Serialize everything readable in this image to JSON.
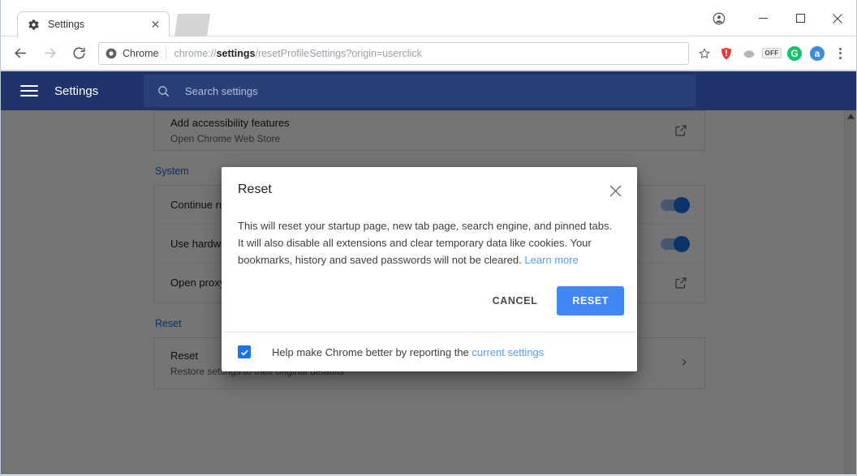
{
  "window": {
    "controls": {
      "avatar": "profile-avatar",
      "minimize": "—",
      "maximize": "□",
      "close": "✕"
    }
  },
  "tabs": [
    {
      "title": "Settings",
      "icon": "gear-icon",
      "close": "✕"
    }
  ],
  "newtab_label": "",
  "toolbar": {
    "back": "←",
    "forward": "→",
    "reload": "⟳",
    "chrome_badge": "Chrome",
    "url_prefix": "chrome://",
    "url_bold": "settings",
    "url_suffix": "/resetProfileSettings?origin=userclick",
    "url_full": "chrome://settings/resetProfileSettings?origin=userclick",
    "star": "☆",
    "extensions": [
      {
        "name": "shield-extension-icon",
        "label": "",
        "color": "#e53935"
      },
      {
        "name": "gray-globe-extension-icon",
        "label": "",
        "color": "#b0b0b0"
      },
      {
        "name": "off-badge-extension-icon",
        "label": "OFF",
        "color": "#4a4a4a"
      },
      {
        "name": "grammarly-extension-icon",
        "label": "G",
        "color": "#15c26b"
      },
      {
        "name": "amazon-assistant-extension-icon",
        "label": "a",
        "color": "#3c8ddc"
      }
    ],
    "menu": "⋮"
  },
  "settings_header": {
    "menu_icon": "hamburger-icon",
    "title": "Settings",
    "search_icon": "search-icon",
    "search_placeholder": "Search settings",
    "search_value": ""
  },
  "settings_page": {
    "accessibility_rows": [
      {
        "title": "Add accessibility features",
        "sub": "Open Chrome Web Store",
        "control": "external-link"
      }
    ],
    "sections": [
      {
        "label": "System",
        "rows": [
          {
            "title": "Continue running background apps when Google Chrome is closed",
            "sub": "",
            "control": "toggle-on"
          },
          {
            "title": "Use hardware acceleration when available",
            "sub": "",
            "control": "toggle-on"
          },
          {
            "title": "Open proxy settings",
            "sub": "",
            "control": "external-link"
          }
        ]
      },
      {
        "label": "Reset",
        "rows": [
          {
            "title": "Reset",
            "sub": "Restore settings to their original defaults",
            "control": "chevron-right"
          }
        ]
      }
    ],
    "scrollbar_arrow": "▲"
  },
  "dialog": {
    "title": "Reset",
    "close_label": "✕",
    "body_text": "This will reset your startup page, new tab page, search engine, and pinned tabs. It will also disable all extensions and clear temporary data like cookies. Your bookmarks, history and saved passwords will not be cleared. ",
    "body_link": "Learn more",
    "cancel_label": "CANCEL",
    "confirm_label": "RESET",
    "footer_text": "Help make Chrome better by reporting the ",
    "footer_link": "current settings",
    "checkbox_checked": true,
    "checkbox_mark": "✓"
  },
  "colors": {
    "settings_header_bg": "#20336b",
    "primary_button": "#4285f4",
    "link": "#5b9bf0",
    "toggle_on": "#1a73e8",
    "checkbox": "#1a73e8",
    "overlay": "rgba(0,0,0,0.54)"
  }
}
